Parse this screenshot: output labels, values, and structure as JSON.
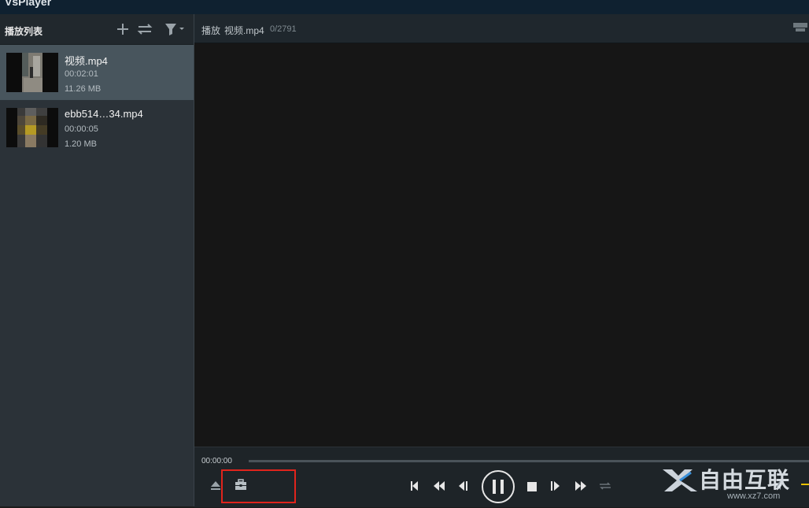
{
  "app": {
    "title": "VsPlayer"
  },
  "sidebar": {
    "title": "播放列表",
    "items": [
      {
        "name": "视频.mp4",
        "duration": "00:02:01",
        "size": "11.26 MB",
        "active": true
      },
      {
        "name": "ebb514…34.mp4",
        "duration": "00:00:05",
        "size": "1.20 MB",
        "active": false
      }
    ],
    "icons": [
      "add-icon",
      "swap-icon",
      "filter-icon"
    ]
  },
  "main": {
    "play_label": "播放",
    "file_name": "视频.mp4",
    "frame_counter": "0/2791"
  },
  "controls": {
    "current_time": "00:00:00",
    "progress": 0,
    "buttons": [
      "eject-icon",
      "toolbox-icon",
      "prev-icon",
      "rewind-icon",
      "step-back-icon",
      "pause-icon",
      "stop-icon",
      "step-forward-icon",
      "fast-forward-icon",
      "loop-icon",
      "volume-icon"
    ]
  },
  "watermark": {
    "text": "自由互联",
    "url": "www.xz7.com"
  },
  "colors": {
    "accent_highlight": "#e0241c",
    "active_row": "#48555d",
    "volume": "#e8c000"
  }
}
